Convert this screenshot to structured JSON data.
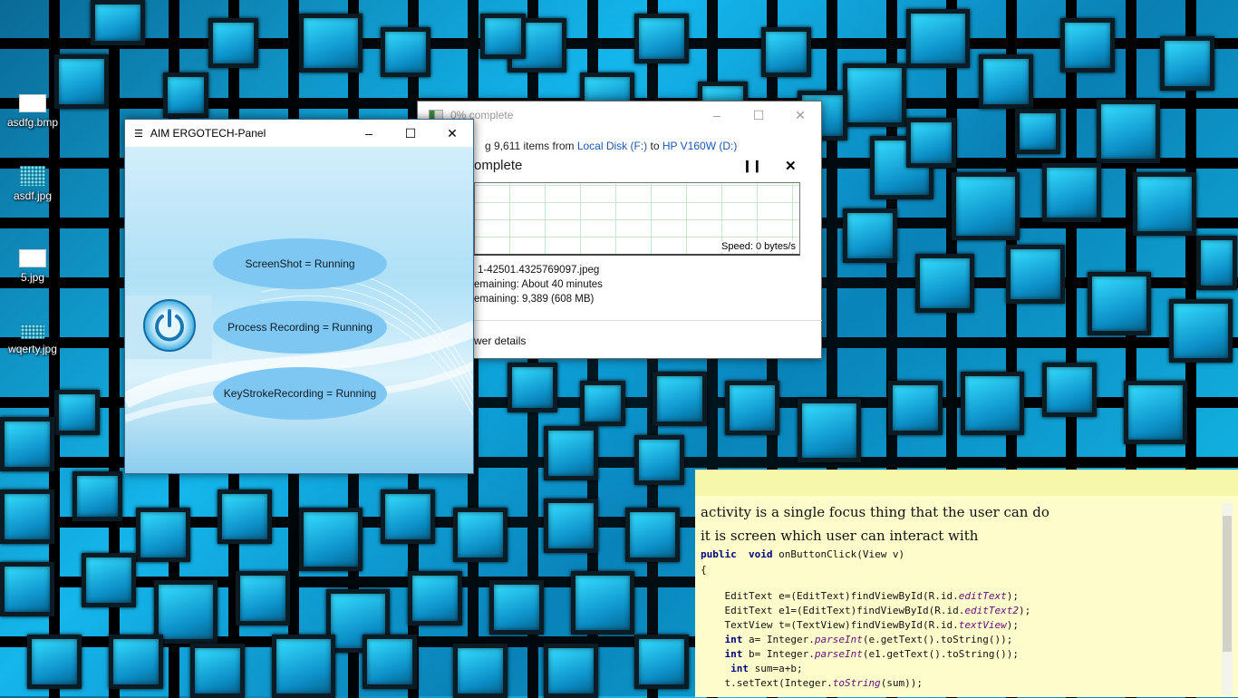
{
  "desktop": {
    "icons": [
      {
        "label": "asdfg.bmp"
      },
      {
        "label": "asdf.jpg"
      },
      {
        "label": "5.jpg"
      },
      {
        "label": "wqerty.jpg"
      }
    ]
  },
  "copy_dialog": {
    "title": "0% complete",
    "copying_prefix": "g 9,611 items from",
    "source": "Local Disk (F:)",
    "to_word": "to",
    "destination": "HP V160W (D:)",
    "progress_heading": "omplete",
    "speed": "Speed: 0 bytes/s",
    "name_line": "1-42501.4325769097.jpeg",
    "time_remaining": "emaining:  About 40 minutes",
    "items_remaining": "emaining:  9,389 (608 MB)",
    "details_toggle": "wer details",
    "pause_icon": "pause-icon",
    "close_icon": "close-icon"
  },
  "aim_panel": {
    "title": "AIM ERGOTECH-Panel",
    "status": {
      "screenshot": "ScreenShot =  Running",
      "process": "Process Recording =  Running",
      "keystroke": "KeyStrokeRecording = Running"
    },
    "power_icon": "power-icon"
  },
  "sticky_note": {
    "lines": [
      "activity is a single focus thing that the user can do",
      "it is screen which user can interact with"
    ],
    "code": {
      "signature_kw": "public  void",
      "signature_rest": " onButtonClick(View v)",
      "open_brace": "{",
      "l1_a": "    EditText e=(EditText)findViewById(R.id.",
      "l1_b": "editText",
      "l1_c": ");",
      "l2_a": "    EditText e1=(EditText)findViewById(R.id.",
      "l2_b": "editText2",
      "l2_c": ");",
      "l3_a": "    TextView t=(TextView)findViewById(R.id.",
      "l3_b": "textView",
      "l3_c": ");",
      "l4_kw": "    int",
      "l4_a": " a= Integer.",
      "l4_b": "parseInt",
      "l4_c": "(e.getText().toString());",
      "l5_kw": "    int",
      "l5_a": " b= Integer.",
      "l5_b": "parseInt",
      "l5_c": "(e1.getText().toString());",
      "l6_kw": "     int",
      "l6_a": " sum=a+b;",
      "l7_a": "    t.setText(Integer.",
      "l7_b": "toString",
      "l7_c": "(sum));"
    }
  }
}
